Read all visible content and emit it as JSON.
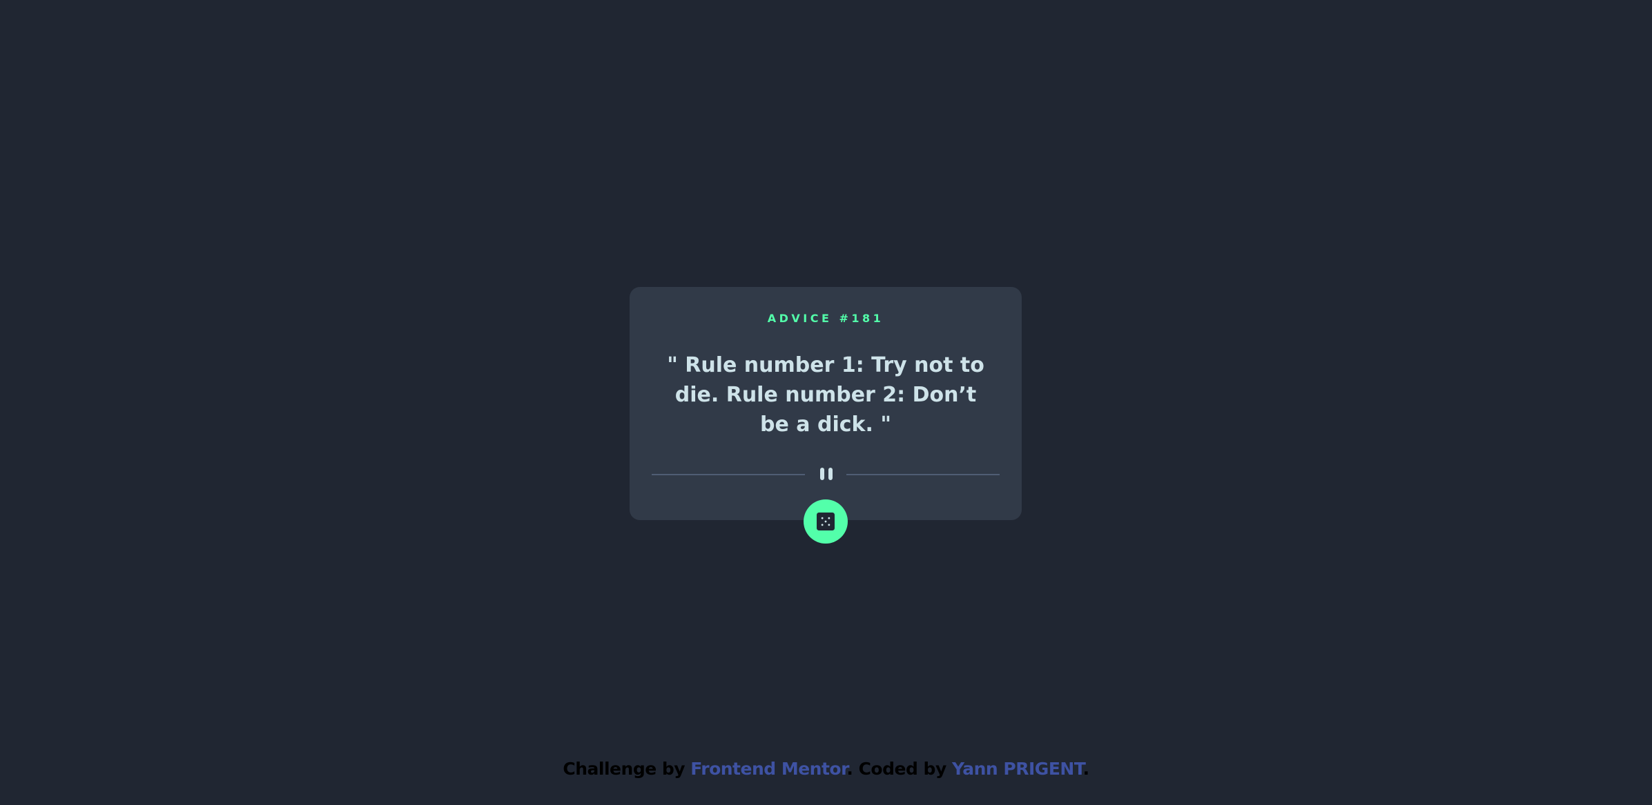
{
  "card": {
    "advice_label": "ADVICE #181",
    "advice_text": "\" Rule number 1: Try not to die. Rule number 2: Don’t be a dick. \""
  },
  "icons": {
    "divider": "pause-icon",
    "button": "dice-icon"
  },
  "footer": {
    "challenge_prefix": "Challenge by ",
    "challenge_link": "Frontend Mentor",
    "coded_prefix": ". Coded by ",
    "coded_link": "Yann PRIGENT",
    "suffix": "."
  },
  "colors": {
    "background": "#202632",
    "card": "#313a48",
    "accent": "#53ffaa",
    "text": "#cee3e9",
    "divider": "#4f5d74",
    "link": "#3e52a3"
  }
}
